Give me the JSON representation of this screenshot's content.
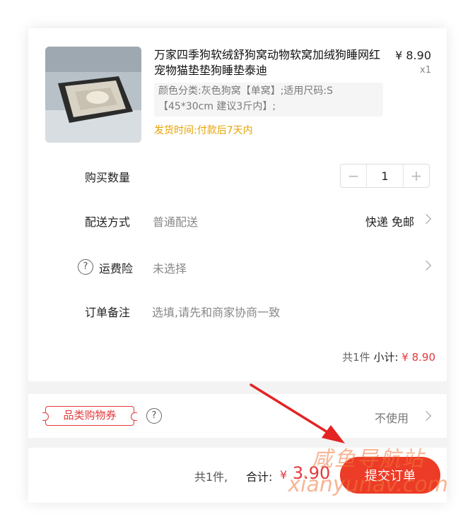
{
  "product": {
    "title": "万家四季狗软绒舒狗窝动物软窝加绒狗睡网红宠物猫垫垫狗睡垫泰迪",
    "price": "¥ 8.90",
    "qty": "x1",
    "sku": "颜色分类:灰色狗窝【单窝】;适用尺码:S【45*30cm 建议3斤内】;",
    "ship_time": "发货时间:付款后7天内"
  },
  "quantity": {
    "label": "购买数量",
    "minus": "−",
    "value": "1",
    "plus": "+"
  },
  "delivery": {
    "label": "配送方式",
    "value": "普通配送",
    "right": "快递 免邮"
  },
  "insurance": {
    "icon_text": "?",
    "label": "运费险",
    "value": "未选择"
  },
  "note": {
    "label": "订单备注",
    "placeholder": "选填,请先和商家协商一致"
  },
  "subtotal": {
    "count": "共1件",
    "label": "小计:",
    "amount": "¥ 8.90"
  },
  "coupon": {
    "tag": "品类购物券",
    "icon_text": "?",
    "value": "不使用"
  },
  "footer": {
    "count": "共1件,",
    "total_label": "合计:",
    "currency": "¥",
    "amount": "3.90",
    "submit": "提交订单"
  },
  "watermark": {
    "zh": "咸鱼导航站",
    "en": "xianyunav.com"
  },
  "colors": {
    "accent": "#ec3b26",
    "price_red": "#e4393c",
    "ship_orange": "#e6a100"
  },
  "icons": [
    "product-thumbnail",
    "minus-icon",
    "plus-icon",
    "question-icon",
    "chevron-right-icon",
    "arrow-annotation"
  ]
}
